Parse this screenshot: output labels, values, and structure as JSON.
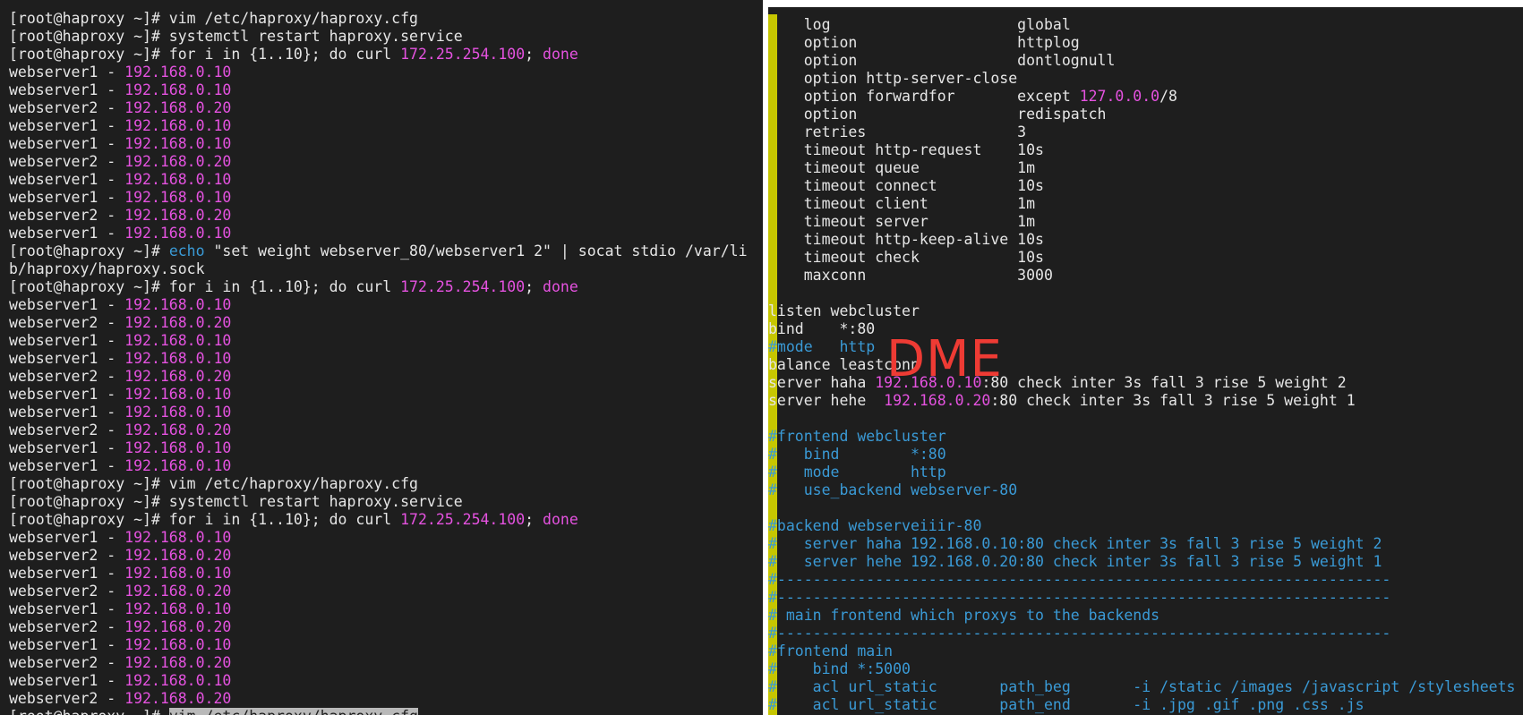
{
  "left_terminal": {
    "lines": [
      [
        {
          "t": "[root@haproxy ~]# vim /etc/haproxy/haproxy.cfg",
          "c": "w"
        }
      ],
      [
        {
          "t": "[root@haproxy ~]# systemctl restart haproxy.service",
          "c": "w"
        }
      ],
      [
        {
          "t": "[root@haproxy ~]# for i in {1..10}; do curl ",
          "c": "w"
        },
        {
          "t": "172.25.254.100",
          "c": "m"
        },
        {
          "t": "; ",
          "c": "w"
        },
        {
          "t": "done",
          "c": "m"
        }
      ],
      [
        {
          "t": "webserver1 - ",
          "c": "w"
        },
        {
          "t": "192.168.0.10",
          "c": "m"
        }
      ],
      [
        {
          "t": "webserver1 - ",
          "c": "w"
        },
        {
          "t": "192.168.0.10",
          "c": "m"
        }
      ],
      [
        {
          "t": "webserver2 - ",
          "c": "w"
        },
        {
          "t": "192.168.0.20",
          "c": "m"
        }
      ],
      [
        {
          "t": "webserver1 - ",
          "c": "w"
        },
        {
          "t": "192.168.0.10",
          "c": "m"
        }
      ],
      [
        {
          "t": "webserver1 - ",
          "c": "w"
        },
        {
          "t": "192.168.0.10",
          "c": "m"
        }
      ],
      [
        {
          "t": "webserver2 - ",
          "c": "w"
        },
        {
          "t": "192.168.0.20",
          "c": "m"
        }
      ],
      [
        {
          "t": "webserver1 - ",
          "c": "w"
        },
        {
          "t": "192.168.0.10",
          "c": "m"
        }
      ],
      [
        {
          "t": "webserver1 - ",
          "c": "w"
        },
        {
          "t": "192.168.0.10",
          "c": "m"
        }
      ],
      [
        {
          "t": "webserver2 - ",
          "c": "w"
        },
        {
          "t": "192.168.0.20",
          "c": "m"
        }
      ],
      [
        {
          "t": "webserver1 - ",
          "c": "w"
        },
        {
          "t": "192.168.0.10",
          "c": "m"
        }
      ],
      [
        {
          "t": "[root@haproxy ~]# ",
          "c": "w"
        },
        {
          "t": "echo",
          "c": "b"
        },
        {
          "t": " \"set weight webserver_80/webserver1 2\" | socat stdio /var/li",
          "c": "w"
        }
      ],
      [
        {
          "t": "b/haproxy/haproxy.sock",
          "c": "w"
        }
      ],
      [
        {
          "t": "[root@haproxy ~]# for i in {1..10}; do curl ",
          "c": "w"
        },
        {
          "t": "172.25.254.100",
          "c": "m"
        },
        {
          "t": "; ",
          "c": "w"
        },
        {
          "t": "done",
          "c": "m"
        }
      ],
      [
        {
          "t": "webserver1 - ",
          "c": "w"
        },
        {
          "t": "192.168.0.10",
          "c": "m"
        }
      ],
      [
        {
          "t": "webserver2 - ",
          "c": "w"
        },
        {
          "t": "192.168.0.20",
          "c": "m"
        }
      ],
      [
        {
          "t": "webserver1 - ",
          "c": "w"
        },
        {
          "t": "192.168.0.10",
          "c": "m"
        }
      ],
      [
        {
          "t": "webserver1 - ",
          "c": "w"
        },
        {
          "t": "192.168.0.10",
          "c": "m"
        }
      ],
      [
        {
          "t": "webserver2 - ",
          "c": "w"
        },
        {
          "t": "192.168.0.20",
          "c": "m"
        }
      ],
      [
        {
          "t": "webserver1 - ",
          "c": "w"
        },
        {
          "t": "192.168.0.10",
          "c": "m"
        }
      ],
      [
        {
          "t": "webserver1 - ",
          "c": "w"
        },
        {
          "t": "192.168.0.10",
          "c": "m"
        }
      ],
      [
        {
          "t": "webserver2 - ",
          "c": "w"
        },
        {
          "t": "192.168.0.20",
          "c": "m"
        }
      ],
      [
        {
          "t": "webserver1 - ",
          "c": "w"
        },
        {
          "t": "192.168.0.10",
          "c": "m"
        }
      ],
      [
        {
          "t": "webserver1 - ",
          "c": "w"
        },
        {
          "t": "192.168.0.10",
          "c": "m"
        }
      ],
      [
        {
          "t": "[root@haproxy ~]# vim /etc/haproxy/haproxy.cfg",
          "c": "w"
        }
      ],
      [
        {
          "t": "[root@haproxy ~]# systemctl restart haproxy.service",
          "c": "w"
        }
      ],
      [
        {
          "t": "[root@haproxy ~]# for i in {1..10}; do curl ",
          "c": "w"
        },
        {
          "t": "172.25.254.100",
          "c": "m"
        },
        {
          "t": "; ",
          "c": "w"
        },
        {
          "t": "done",
          "c": "m"
        }
      ],
      [
        {
          "t": "webserver1 - ",
          "c": "w"
        },
        {
          "t": "192.168.0.10",
          "c": "m"
        }
      ],
      [
        {
          "t": "webserver2 - ",
          "c": "w"
        },
        {
          "t": "192.168.0.20",
          "c": "m"
        }
      ],
      [
        {
          "t": "webserver1 - ",
          "c": "w"
        },
        {
          "t": "192.168.0.10",
          "c": "m"
        }
      ],
      [
        {
          "t": "webserver2 - ",
          "c": "w"
        },
        {
          "t": "192.168.0.20",
          "c": "m"
        }
      ],
      [
        {
          "t": "webserver1 - ",
          "c": "w"
        },
        {
          "t": "192.168.0.10",
          "c": "m"
        }
      ],
      [
        {
          "t": "webserver2 - ",
          "c": "w"
        },
        {
          "t": "192.168.0.20",
          "c": "m"
        }
      ],
      [
        {
          "t": "webserver1 - ",
          "c": "w"
        },
        {
          "t": "192.168.0.10",
          "c": "m"
        }
      ],
      [
        {
          "t": "webserver2 - ",
          "c": "w"
        },
        {
          "t": "192.168.0.20",
          "c": "m"
        }
      ],
      [
        {
          "t": "webserver1 - ",
          "c": "w"
        },
        {
          "t": "192.168.0.10",
          "c": "m"
        }
      ],
      [
        {
          "t": "webserver2 - ",
          "c": "w"
        },
        {
          "t": "192.168.0.20",
          "c": "m"
        }
      ],
      [
        {
          "t": "[root@haproxy ~]# ",
          "c": "w"
        },
        {
          "t": "vim /etc/haproxy/haproxy.cfg",
          "c": "hl"
        }
      ]
    ]
  },
  "right_editor": {
    "lines": [
      [
        {
          "t": "    log                     global",
          "c": "w"
        }
      ],
      [
        {
          "t": "    option                  httplog",
          "c": "w"
        }
      ],
      [
        {
          "t": "    option                  dontlognull",
          "c": "w"
        }
      ],
      [
        {
          "t": "    option http-server-close",
          "c": "w"
        }
      ],
      [
        {
          "t": "    option forwardfor       except ",
          "c": "w"
        },
        {
          "t": "127.0.0.0",
          "c": "m"
        },
        {
          "t": "/8",
          "c": "w"
        }
      ],
      [
        {
          "t": "    option                  redispatch",
          "c": "w"
        }
      ],
      [
        {
          "t": "    retries                 3",
          "c": "w"
        }
      ],
      [
        {
          "t": "    timeout http-request    10s",
          "c": "w"
        }
      ],
      [
        {
          "t": "    timeout queue           1m",
          "c": "w"
        }
      ],
      [
        {
          "t": "    timeout connect         10s",
          "c": "w"
        }
      ],
      [
        {
          "t": "    timeout client          1m",
          "c": "w"
        }
      ],
      [
        {
          "t": "    timeout server          1m",
          "c": "w"
        }
      ],
      [
        {
          "t": "    timeout http-keep-alive 10s",
          "c": "w"
        }
      ],
      [
        {
          "t": "    timeout check           10s",
          "c": "w"
        }
      ],
      [
        {
          "t": "    maxconn                 3000",
          "c": "w"
        }
      ],
      [
        {
          "t": "",
          "c": "w"
        }
      ],
      [
        {
          "t": "listen webcluster",
          "c": "w"
        }
      ],
      [
        {
          "t": "bind    *:80",
          "c": "w"
        }
      ],
      [
        {
          "t": "#mode   http",
          "c": "b"
        }
      ],
      [
        {
          "t": "balance leastconn",
          "c": "w"
        }
      ],
      [
        {
          "t": "server haha ",
          "c": "w"
        },
        {
          "t": "192.168.0.10",
          "c": "m"
        },
        {
          "t": ":80 check inter 3s fall 3 rise 5 weight 2",
          "c": "w"
        }
      ],
      [
        {
          "t": "server hehe  ",
          "c": "w"
        },
        {
          "t": "192.168.0.20",
          "c": "m"
        },
        {
          "t": ":80 check inter 3s fall 3 rise 5 weight 1",
          "c": "w"
        }
      ],
      [
        {
          "t": "",
          "c": "w"
        }
      ],
      [
        {
          "t": "#frontend webcluster",
          "c": "b"
        }
      ],
      [
        {
          "t": "#   bind        *:80",
          "c": "b"
        }
      ],
      [
        {
          "t": "#   mode        http",
          "c": "b"
        }
      ],
      [
        {
          "t": "#   use_backend webserver-80",
          "c": "b"
        }
      ],
      [
        {
          "t": "",
          "c": "w"
        }
      ],
      [
        {
          "t": "#backend webserveiiir-80",
          "c": "b"
        }
      ],
      [
        {
          "t": "#   server haha 192.168.0.10:80 check inter 3s fall 3 rise 5 weight 2",
          "c": "b"
        }
      ],
      [
        {
          "t": "#   server hehe 192.168.0.20:80 check inter 3s fall 3 rise 5 weight 1",
          "c": "b"
        }
      ],
      [
        {
          "t": "#---------------------------------------------------------------------",
          "c": "b"
        }
      ],
      [
        {
          "t": "#---------------------------------------------------------------------",
          "c": "b"
        }
      ],
      [
        {
          "t": "# main frontend which proxys to the backends",
          "c": "b"
        }
      ],
      [
        {
          "t": "#---------------------------------------------------------------------",
          "c": "b"
        }
      ],
      [
        {
          "t": "#frontend main",
          "c": "b"
        }
      ],
      [
        {
          "t": "#    bind *:5000",
          "c": "b"
        }
      ],
      [
        {
          "t": "#    acl url_static       path_beg       -i /static /images /javascript /stylesheets",
          "c": "b"
        }
      ],
      [
        {
          "t": "#    acl url_static       path_end       -i .jpg .gif .png .css .js",
          "c": "b"
        }
      ]
    ]
  },
  "watermark": {
    "text": "DME"
  },
  "colors": {
    "background": "#1e1e1e",
    "text": "#e6e6e6",
    "magenta": "#e552e0",
    "comment_blue": "#3a9ad6",
    "gutter_yellow": "#c6c600",
    "watermark_red": "#ee3b34"
  }
}
